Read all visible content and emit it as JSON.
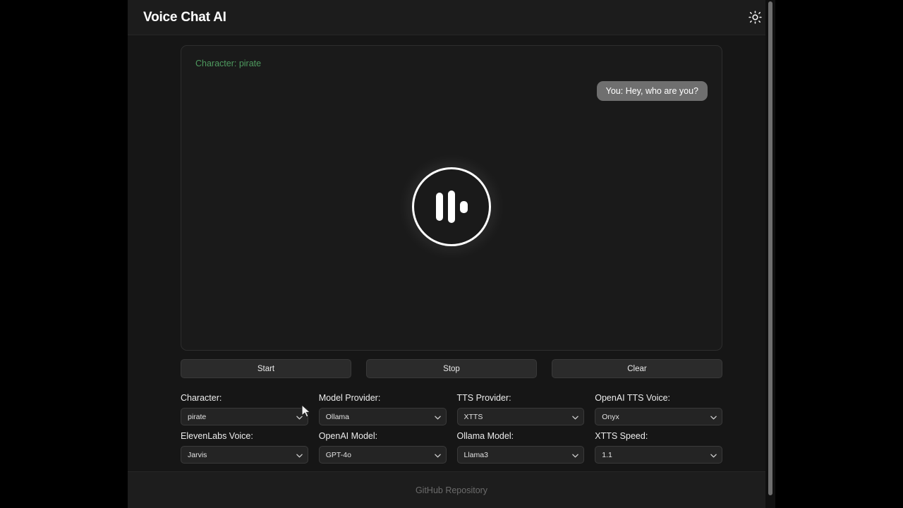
{
  "header": {
    "title": "Voice Chat AI",
    "theme_toggle_icon": "sun-icon"
  },
  "chat": {
    "character_banner": "Character: pirate",
    "messages": [
      {
        "sender": "You",
        "text": "You: Hey, who are you?",
        "align": "right"
      }
    ],
    "visualizer": {
      "icon": "audio-waveform-icon",
      "state": "active"
    }
  },
  "controls": {
    "start_label": "Start",
    "stop_label": "Stop",
    "clear_label": "Clear"
  },
  "settings": [
    {
      "label": "Character:",
      "value": "pirate",
      "name": "character"
    },
    {
      "label": "Model Provider:",
      "value": "Ollama",
      "name": "model-provider"
    },
    {
      "label": "TTS Provider:",
      "value": "XTTS",
      "name": "tts-provider"
    },
    {
      "label": "OpenAI TTS Voice:",
      "value": "Onyx",
      "name": "openai-tts-voice"
    },
    {
      "label": "ElevenLabs Voice:",
      "value": "Jarvis",
      "name": "elevenlabs-voice"
    },
    {
      "label": "OpenAI Model:",
      "value": "GPT-4o",
      "name": "openai-model"
    },
    {
      "label": "Ollama Model:",
      "value": "Llama3",
      "name": "ollama-model"
    },
    {
      "label": "XTTS Speed:",
      "value": "1.1",
      "name": "xtts-speed"
    }
  ],
  "footer": {
    "link_label": "GitHub Repository"
  },
  "colors": {
    "page_background": "#000000",
    "app_background": "#161616",
    "header_background": "#1c1c1c",
    "panel_background": "#1a1a1a",
    "accent_green": "#4e9a5f",
    "bubble_gray": "#6f6f6f",
    "button_gray": "#2b2b2b",
    "text_primary": "#ffffff",
    "text_muted": "#6b6b6b"
  }
}
